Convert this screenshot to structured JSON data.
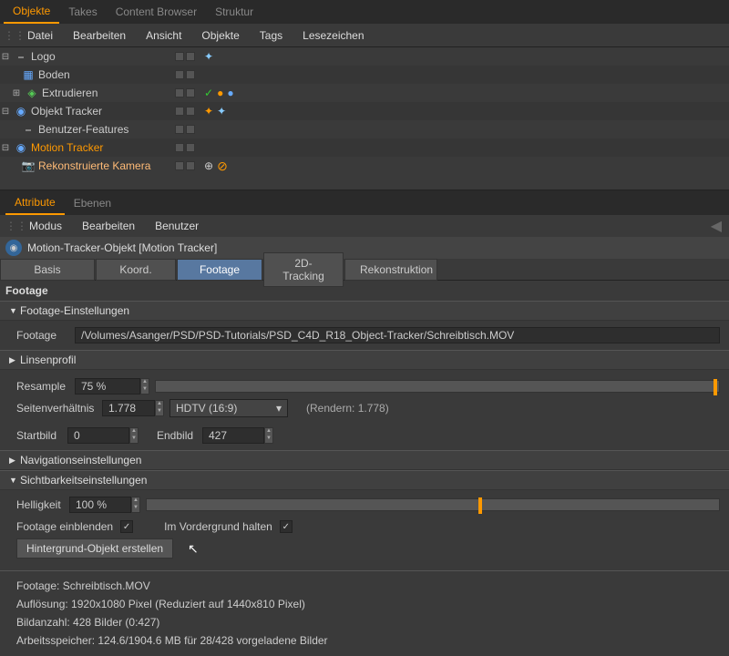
{
  "topTabs": {
    "objekte": "Objekte",
    "takes": "Takes",
    "content": "Content Browser",
    "struktur": "Struktur"
  },
  "topMenu": {
    "datei": "Datei",
    "bearbeiten": "Bearbeiten",
    "ansicht": "Ansicht",
    "objekte": "Objekte",
    "tags": "Tags",
    "lesezeichen": "Lesezeichen"
  },
  "tree": {
    "logo": "Logo",
    "boden": "Boden",
    "extrudieren": "Extrudieren",
    "tracker": "Objekt Tracker",
    "features": "Benutzer-Features",
    "motion": "Motion Tracker",
    "kamera": "Rekonstruierte Kamera"
  },
  "attrTabs": {
    "attribute": "Attribute",
    "ebenen": "Ebenen"
  },
  "attrMenu": {
    "modus": "Modus",
    "bearbeiten": "Bearbeiten",
    "benutzer": "Benutzer"
  },
  "objTitle": "Motion-Tracker-Objekt [Motion Tracker]",
  "subTabs": {
    "basis": "Basis",
    "koord": "Koord.",
    "footage": "Footage",
    "tracking": "2D-Tracking",
    "rekon": "Rekonstruktion"
  },
  "sectionFootage": "Footage",
  "groups": {
    "settings": "Footage-Einstellungen",
    "linsen": "Linsenprofil",
    "nav": "Navigationseinstellungen",
    "sicht": "Sichtbarkeitseinstellungen"
  },
  "labels": {
    "footage": "Footage",
    "resample": "Resample",
    "seiten": "Seitenverhältnis",
    "rendern": "(Rendern: 1.778)",
    "startbild": "Startbild",
    "endbild": "Endbild",
    "helligkeit": "Helligkeit",
    "einblenden": "Footage einblenden",
    "vordergrund": "Im Vordergrund halten",
    "hintergrund": "Hintergrund-Objekt erstellen"
  },
  "values": {
    "footagePath": "/Volumes/Asanger/PSD/PSD-Tutorials/PSD_C4D_R18_Object-Tracker/Schreibtisch.MOV",
    "resample": "75 %",
    "seiten": "1.778",
    "hdtv": "HDTV (16:9)",
    "start": "0",
    "end": "427",
    "hell": "100 %"
  },
  "info": {
    "l1": "Footage: Schreibtisch.MOV",
    "l2": "Auflösung: 1920x1080 Pixel (Reduziert auf 1440x810 Pixel)",
    "l3": "Bildanzahl: 428 Bilder (0:427)",
    "l4": "Arbeitsspeicher: 124.6/1904.6 MB für 28/428 vorgeladene Bilder"
  }
}
